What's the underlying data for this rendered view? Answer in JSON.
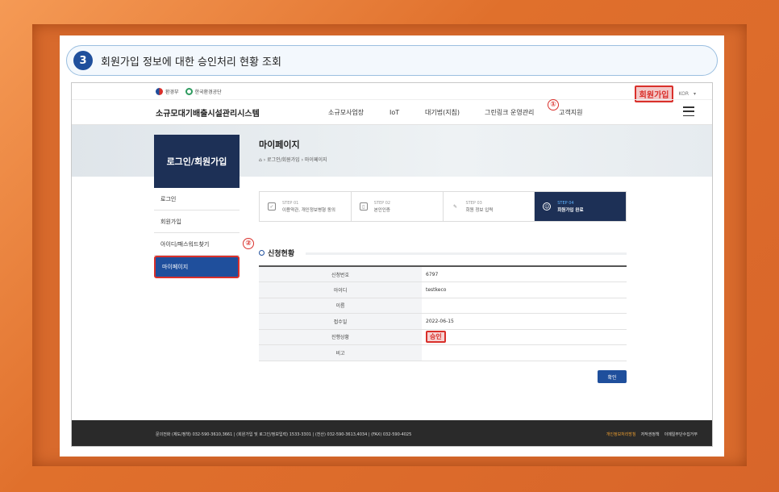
{
  "banner": {
    "number": "3",
    "text": "회원가입 정보에 대한 승인처리 현황 조회"
  },
  "topbar": {
    "logo1": "환경부",
    "logo2": "한국환경공단",
    "join_label": "회원가입",
    "lang": "KOR"
  },
  "nav": {
    "site_title": "소규모대기배출시설관리시스템",
    "items": [
      "소규모사업장",
      "IoT",
      "대기법(지침)",
      "그린링크 운영관리",
      "고객지원"
    ]
  },
  "markers": {
    "one": "①",
    "two": "②"
  },
  "hero": {
    "title": "마이페이지",
    "breadcrumb": "⌂ › 로그인/회원가입 › 마이페이지"
  },
  "sidebar": {
    "heading": "로그인/회원가입",
    "items": [
      {
        "label": "로그인"
      },
      {
        "label": "회원가입"
      },
      {
        "label": "아이디/패스워드찾기"
      },
      {
        "label": "마이페이지"
      }
    ]
  },
  "steps": [
    {
      "label": "STEP 01",
      "name": "이용약관, 개인정보병형 동의"
    },
    {
      "label": "STEP 02",
      "name": "본인인증"
    },
    {
      "label": "STEP 03",
      "name": "회원 정보 입력"
    },
    {
      "label": "STEP 04",
      "name": "회원가입 완료"
    }
  ],
  "section": {
    "title": "신청현황"
  },
  "table": [
    {
      "header": "신청번호",
      "value": "6797"
    },
    {
      "header": "아이디",
      "value": "testkeco"
    },
    {
      "header": "이름",
      "value": ""
    },
    {
      "header": "접수일",
      "value": "2022-06-15"
    },
    {
      "header": "진행상황",
      "value": "승인"
    },
    {
      "header": "비고",
      "value": ""
    }
  ],
  "confirm_label": "확인",
  "footer": {
    "contact": "문의전화 (제도/정책) 032-590-3610,3661 | (회원가입 및 로그인/정보입력) 1533-3301 | (전산) 032-590-3613,4034 | (FAX) 032-590-4025",
    "links": [
      "개인정보처리방침",
      "저작권정책",
      "이메일무단수집거부"
    ]
  },
  "colors": {
    "frame": "#e87a35",
    "navy": "#1d3056",
    "blue": "#1f4f9c",
    "highlight": "#d9302b"
  }
}
